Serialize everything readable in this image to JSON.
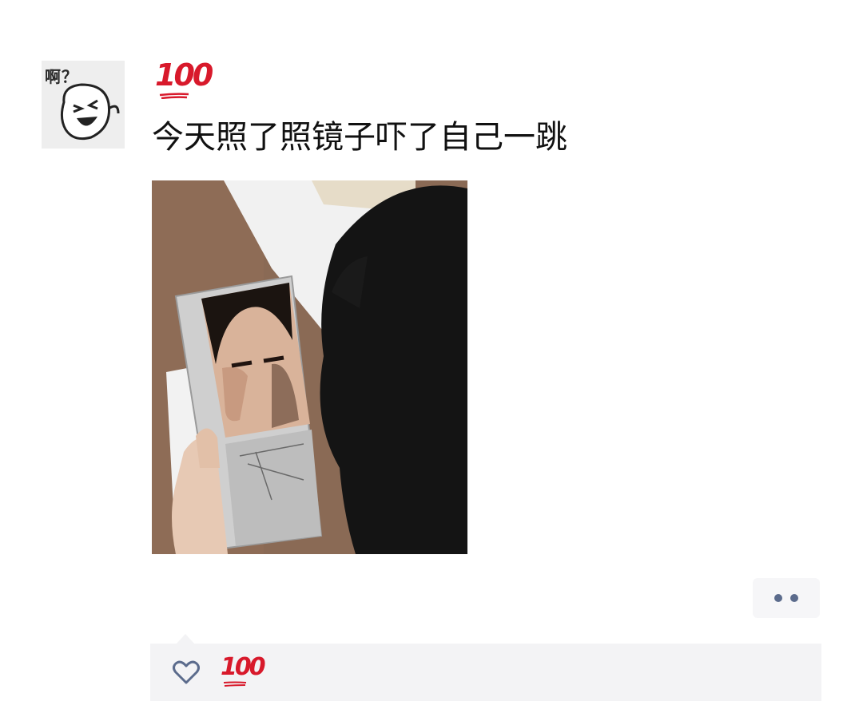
{
  "post": {
    "avatar_caption": "啊？",
    "username": "100",
    "text": "今天照了照镜子吓了自己一跳",
    "photo_icon": "selfie-mirror-photo"
  },
  "actions": {
    "more_icon": "more-dots-icon"
  },
  "likes": {
    "icon": "heart-outline-icon",
    "names": [
      "100"
    ]
  },
  "colors": {
    "emoji_red": "#d8192b",
    "dots": "#5b6b8c",
    "panel_bg": "#f3f3f5"
  }
}
